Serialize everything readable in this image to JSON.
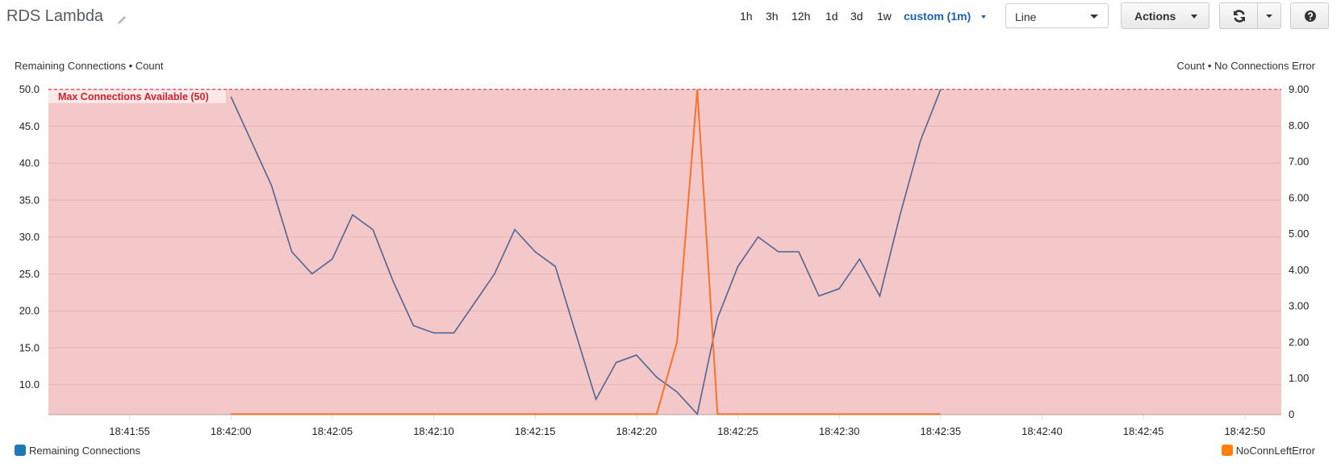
{
  "header": {
    "title": "RDS Lambda",
    "edit_icon": "pencil-icon",
    "time_ranges": [
      "1h",
      "3h",
      "12h",
      "1d",
      "3d",
      "1w"
    ],
    "custom_range": "custom (1m)",
    "view_select": "Line",
    "actions_label": "Actions",
    "refresh_icon": "refresh-icon",
    "help_icon": "question-circle-icon"
  },
  "colors": {
    "series_remaining": "#4d6694",
    "series_error": "#f6732a",
    "legend_remaining": "#1f77b4",
    "legend_error": "#ff7f0e",
    "threshold_fill": "#f4c7c8",
    "threshold_line": "#d0202b",
    "accent": "#1a62b5"
  },
  "chart_data": {
    "type": "line",
    "title": "",
    "left_axis_title": "Remaining Connections • Count",
    "right_axis_title": "Count • No Connections Error",
    "x_unit": "seconds after 18:42:00",
    "x_range": [
      -9.0,
      51.8
    ],
    "x_ticks": [
      {
        "t": -5,
        "label": "18:41:55"
      },
      {
        "t": 0,
        "label": "18:42:00"
      },
      {
        "t": 5,
        "label": "18:42:05"
      },
      {
        "t": 10,
        "label": "18:42:10"
      },
      {
        "t": 15,
        "label": "18:42:15"
      },
      {
        "t": 20,
        "label": "18:42:20"
      },
      {
        "t": 25,
        "label": "18:42:25"
      },
      {
        "t": 30,
        "label": "18:42:30"
      },
      {
        "t": 35,
        "label": "18:42:35"
      },
      {
        "t": 40,
        "label": "18:42:40"
      },
      {
        "t": 45,
        "label": "18:42:45"
      },
      {
        "t": 50,
        "label": "18:42:50"
      }
    ],
    "left_axis": {
      "range": [
        6,
        50
      ],
      "ticks": [
        "10.0",
        "15.0",
        "20.0",
        "25.0",
        "30.0",
        "35.0",
        "40.0",
        "45.0",
        "50.0"
      ],
      "tick_values": [
        10,
        15,
        20,
        25,
        30,
        35,
        40,
        45,
        50
      ]
    },
    "right_axis": {
      "range": [
        0,
        9
      ],
      "ticks": [
        "0",
        "1.00",
        "2.00",
        "3.00",
        "4.00",
        "5.00",
        "6.00",
        "7.00",
        "8.00",
        "9.00"
      ],
      "tick_values": [
        0,
        1,
        2,
        3,
        4,
        5,
        6,
        7,
        8,
        9
      ]
    },
    "grid": true,
    "threshold": {
      "label": "Max Connections Available (50)",
      "value": 50,
      "axis": "left",
      "shaded": "below"
    },
    "legend_position": "bottom",
    "series": [
      {
        "name": "Remaining Connections",
        "axis": "left",
        "x": [
          0,
          2,
          3,
          4,
          5,
          6,
          7,
          8,
          9,
          10,
          11,
          12,
          13,
          14,
          15,
          16,
          17,
          18,
          19,
          20,
          21,
          22,
          23,
          24,
          25,
          26,
          27,
          28,
          29,
          30,
          31,
          32,
          33,
          34,
          35
        ],
        "values": [
          49,
          37,
          28,
          25,
          27,
          33,
          31,
          24,
          18,
          17,
          17,
          21,
          25,
          31,
          28,
          26,
          17,
          8,
          13,
          14,
          11,
          9,
          6,
          19,
          26,
          30,
          28,
          28,
          22,
          23,
          27,
          22,
          33,
          43,
          50
        ]
      },
      {
        "name": "NoConnLeftError",
        "axis": "right",
        "x": [
          0,
          21,
          22,
          23,
          24,
          35
        ],
        "values": [
          0,
          0,
          2,
          9,
          0,
          0
        ]
      }
    ]
  }
}
